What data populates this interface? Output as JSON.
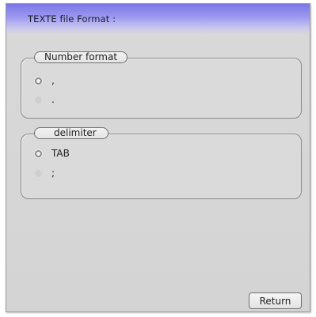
{
  "dialog": {
    "title": "TEXTE file Format :"
  },
  "number_format": {
    "legend": "Number format",
    "options": [
      {
        "label": ",",
        "selected": true
      },
      {
        "label": ".",
        "selected": false
      }
    ]
  },
  "delimiter": {
    "legend": "delimiter",
    "options": [
      {
        "label": "TAB",
        "selected": true
      },
      {
        "label": ";",
        "selected": false
      }
    ]
  },
  "buttons": {
    "return_label": "Return"
  }
}
